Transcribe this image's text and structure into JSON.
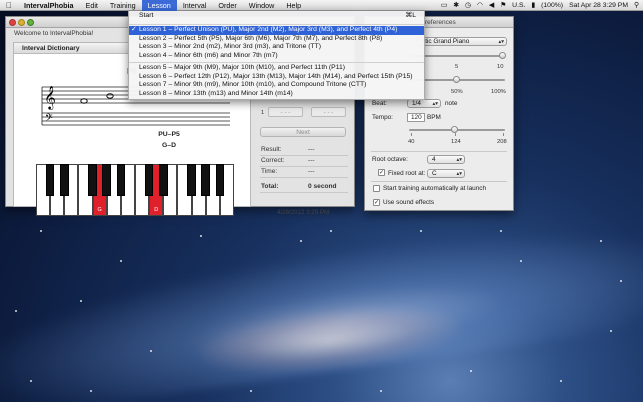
{
  "menubar": {
    "apple": "",
    "app_name": "IntervalPhobia",
    "menus": [
      "Edit",
      "Training",
      "Lesson",
      "Interval",
      "Order",
      "Window",
      "Help"
    ],
    "open_menu": "Lesson",
    "status": {
      "battery": "(100%)",
      "keyboard": "U.S.",
      "clock": "Sat Apr 28  3:29 PM"
    }
  },
  "lesson_menu": {
    "items": [
      {
        "label": "Start",
        "shortcut": "⌘L",
        "checked": false
      },
      {
        "label": "Lesson 1 – Perfect Unison (PU), Major 2nd (M2), Major 3rd (M3), and Perfect 4th (P4)",
        "checked": true
      },
      {
        "label": "Lesson 2 – Perfect 5th (P5), Major 6th (M6), Major 7th (M7), and Perfect 8th (P8)",
        "checked": false
      },
      {
        "label": "Lesson 3 – Minor 2nd (m2), Minor 3rd (m3), and Tritone (TT)",
        "checked": false
      },
      {
        "label": "Lesson 4 – Minor 6th (m6) and Minor 7th (m7)",
        "checked": false
      },
      {
        "label": "Lesson 5 – Major 9th (M9), Major 10th (M10), and Perfect 11th (P11)",
        "checked": false
      },
      {
        "label": "Lesson 6 – Perfect 12th (P12), Major 13th (M13), Major 14th (M14), and Perfect 15th (P15)",
        "checked": false
      },
      {
        "label": "Lesson 7 – Minor 9th (m9), Minor 10th (m10), and Compound Tritone (CTT)",
        "checked": false
      },
      {
        "label": "Lesson 8 – Minor 13th (m13) and Minor 14th (m14)",
        "checked": false
      }
    ]
  },
  "main_window": {
    "welcome": "Welcome to IntervalPhobia!",
    "dictionary_header": "Interval Dictionary",
    "interval_title": "P5",
    "interval_name": "PU–P5",
    "interval_notes": "G–D",
    "highlighted_keys": [
      "G",
      "D"
    ],
    "ctrl_label": "1",
    "next_label": "Next",
    "result_label": "Result:",
    "result_value": "---",
    "correct_label": "Correct:",
    "correct_value": "---",
    "time_label": "Time:",
    "time_value": "---",
    "total_label": "Total:",
    "total_value": "0 second",
    "date": "4/28/2012 3:29 PM"
  },
  "prefs": {
    "title": "references",
    "instrument": "stic Grand Piano",
    "volume_ticks": [
      "5",
      "10"
    ],
    "speed_ticks": [
      "50%",
      "100%"
    ],
    "beat_label": "Beat:",
    "beat_value": "1/4",
    "beat_unit": "note",
    "tempo_label": "Tempo:",
    "tempo_value": "120",
    "tempo_unit": "BPM",
    "tempo_ticks": [
      "40",
      "124",
      "208"
    ],
    "root_octave_label": "Root octave:",
    "root_octave_value": "4",
    "fixed_root_label": "Fixed root at:",
    "fixed_root_value": "C",
    "auto_train_label": "Start training automatically at launch",
    "sound_effects_label": "Use sound effects"
  }
}
